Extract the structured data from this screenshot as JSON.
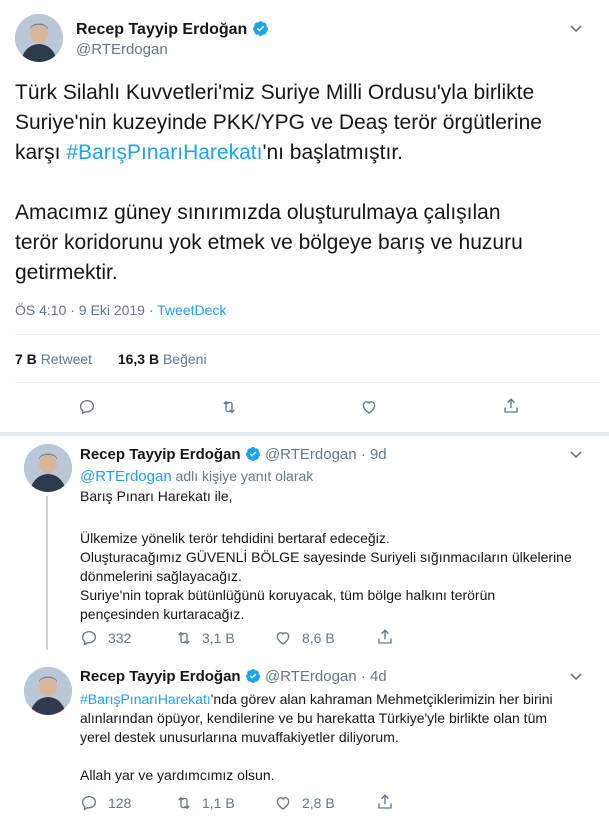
{
  "main_tweet": {
    "author_name": "Recep Tayyip Erdoğan",
    "handle": "@RTErdogan",
    "text_line1": "Türk Silahlı Kuvvetleri'miz Suriye Milli Ordusu'yla birlikte",
    "text_line2": "Suriye'nin kuzeyinde PKK/YPG ve Deaş terör örgütlerine",
    "text_line3_pre": "karşı ",
    "hashtag": "#BarışPınarıHarekatı",
    "text_line3_post": "'nı başlatmıştır.",
    "para2_line1": "Amacımız güney sınırımızda oluşturulmaya çalışılan",
    "para2_line2": "terör koridorunu yok etmek ve bölgeye barış ve huzuru",
    "para2_line3": "getirmektir.",
    "time": "ÖS 4:10 · 9 Eki 2019 · ",
    "source": "TweetDeck",
    "retweet_count": "7 B",
    "retweet_label": "Retweet",
    "like_count": "16,3 B",
    "like_label": "Beğeni"
  },
  "reply1": {
    "author_name": "Recep Tayyip Erdoğan",
    "handle": "@RTErdogan",
    "age": "· 9d",
    "reply_to_handle": "@RTErdogan",
    "reply_to_suffix": " adlı kişiye yanıt olarak",
    "lines": [
      "Barış Pınarı Harekatı ile,",
      "",
      "Ülkemize yönelik terör tehdidini bertaraf edeceğiz.",
      "Oluşturacağımız GÜVENLİ BÖLGE sayesinde Suriyeli sığınmacıların ülkelerine",
      "dönmelerini sağlayacağız.",
      "Suriye'nin toprak bütünlüğünü koruyacak, tüm bölge halkını terörün",
      "pençesinden kurtaracağız."
    ],
    "replies": "332",
    "retweets": "3,1 B",
    "likes": "8,6 B"
  },
  "reply2": {
    "author_name": "Recep Tayyip Erdoğan",
    "handle": "@RTErdogan",
    "age": "· 4d",
    "hashtag": "#BarışPınarıHarekatı",
    "line1_post": "'nda görev alan kahraman Mehmetçiklerimizin her birini",
    "line2": "alınlarından öpüyor, kendilerine ve bu harekatta Türkiye'yle birlikte olan tüm",
    "line3": "yerel destek unusurlarına muvaffakiyetler diliyorum.",
    "line4": "",
    "line5": "Allah yar ve yardımcımız olsun.",
    "replies": "128",
    "retweets": "1,1 B",
    "likes": "2,8 B"
  },
  "colors": {
    "accent": "#1da1f2",
    "muted": "#657786",
    "divider": "#e6ecf0"
  }
}
